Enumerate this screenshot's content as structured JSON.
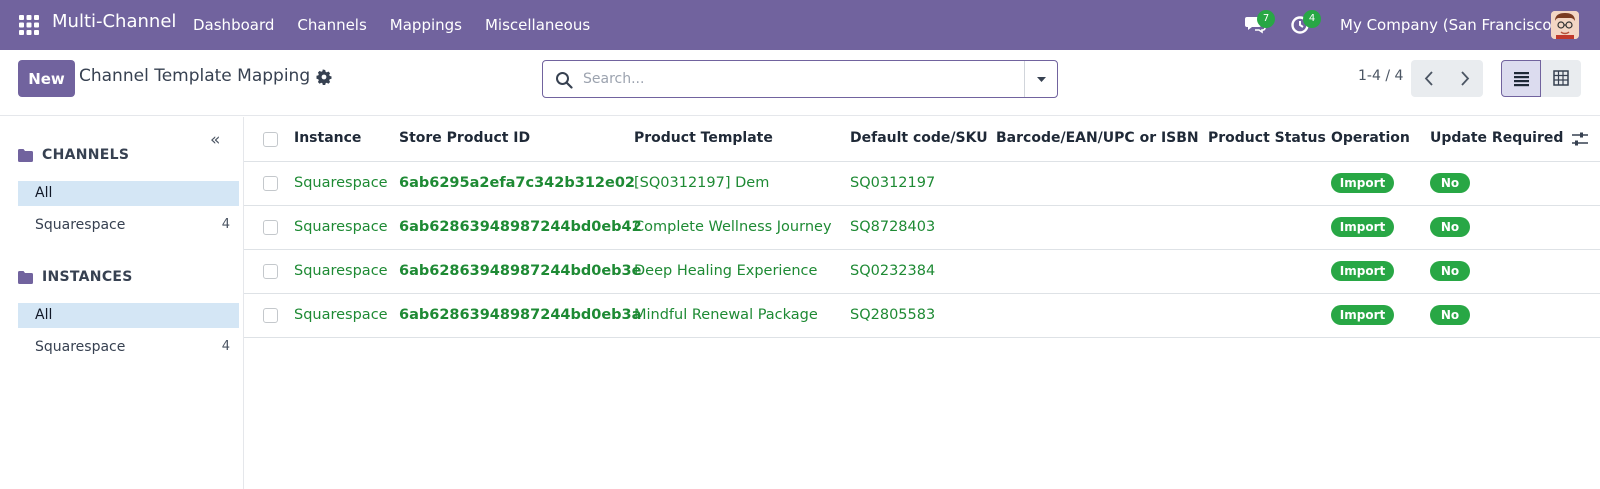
{
  "navbar": {
    "app_name": "Multi-Channel",
    "menu": [
      "Dashboard",
      "Channels",
      "Mappings",
      "Miscellaneous"
    ],
    "messages_count": "7",
    "activities_count": "4",
    "company": "My Company (San Francisco)",
    "color": "#71639e"
  },
  "control_panel": {
    "new_label": "New",
    "title": "Channel Template Mapping",
    "search_placeholder": "Search...",
    "pager_value": "1-4 / 4"
  },
  "sidebar": {
    "sections": [
      {
        "label": "CHANNELS",
        "items": [
          {
            "label": "All",
            "count": ""
          },
          {
            "label": "Squarespace",
            "count": "4"
          }
        ]
      },
      {
        "label": "INSTANCES",
        "items": [
          {
            "label": "All",
            "count": ""
          },
          {
            "label": "Squarespace",
            "count": "4"
          }
        ]
      }
    ]
  },
  "table": {
    "columns": [
      "Instance",
      "Store Product ID",
      "Product Template",
      "Default code/SKU",
      "Barcode/EAN/UPC or ISBN",
      "Product Status",
      "Operation",
      "Update Required"
    ],
    "rows": [
      {
        "instance": "Squarespace",
        "store_product_id": "6ab6295a2efa7c342b312e02",
        "product_template": "[SQ0312197] Dem",
        "sku": "SQ0312197",
        "barcode": "",
        "status": "",
        "operation": "Import",
        "update_required": "No"
      },
      {
        "instance": "Squarespace",
        "store_product_id": "6ab62863948987244bd0eb42",
        "product_template": "Complete Wellness Journey",
        "sku": "SQ8728403",
        "barcode": "",
        "status": "",
        "operation": "Import",
        "update_required": "No"
      },
      {
        "instance": "Squarespace",
        "store_product_id": "6ab62863948987244bd0eb3e",
        "product_template": "Deep Healing Experience",
        "sku": "SQ0232384",
        "barcode": "",
        "status": "",
        "operation": "Import",
        "update_required": "No"
      },
      {
        "instance": "Squarespace",
        "store_product_id": "6ab62863948987244bd0eb3a",
        "product_template": "Mindful Renewal Package",
        "sku": "SQ2805583",
        "barcode": "",
        "status": "",
        "operation": "Import",
        "update_required": "No"
      }
    ]
  }
}
